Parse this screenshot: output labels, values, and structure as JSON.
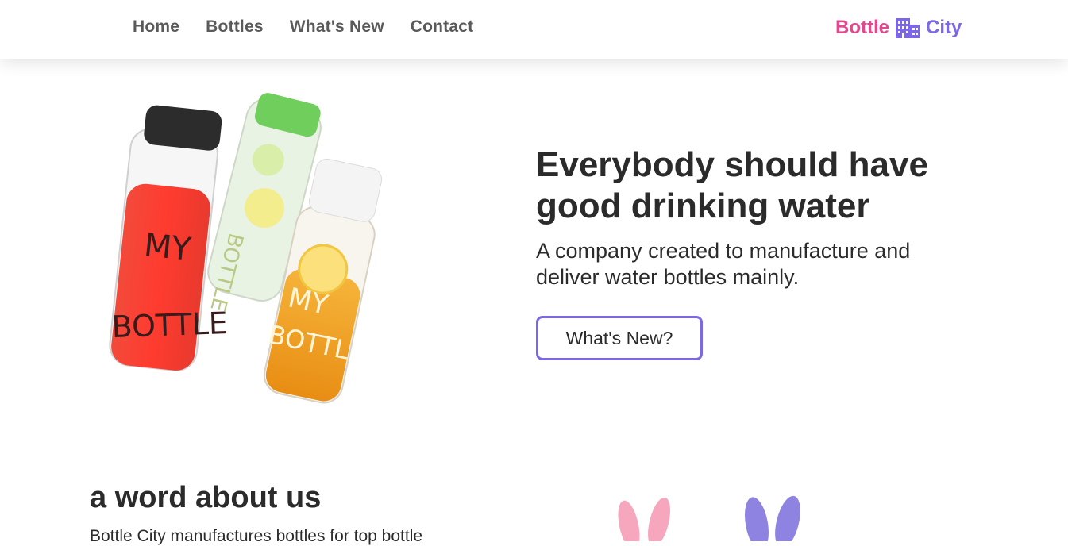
{
  "nav": {
    "links": [
      "Home",
      "Bottles",
      "What's New",
      "Contact"
    ],
    "brand_part_1": "Bottle",
    "brand_part_2": "City",
    "brand_icon": "city-building-icon",
    "brand_colors": {
      "pink": "#e4488c",
      "purple": "#7b67e8"
    }
  },
  "hero": {
    "image": "water-bottles-image",
    "title": "Everybody should have good drinking water",
    "subtitle": "A company created to manufacture and deliver water bottles mainly.",
    "cta_label": "What's New?"
  },
  "about": {
    "title": "a word about us",
    "text": "Bottle City manufactures bottles for top bottle",
    "image": "bunny-ears-image"
  },
  "colors": {
    "accent": "#7b67e8",
    "text": "#2b2b2b",
    "nav_text": "#5a5a5a"
  }
}
